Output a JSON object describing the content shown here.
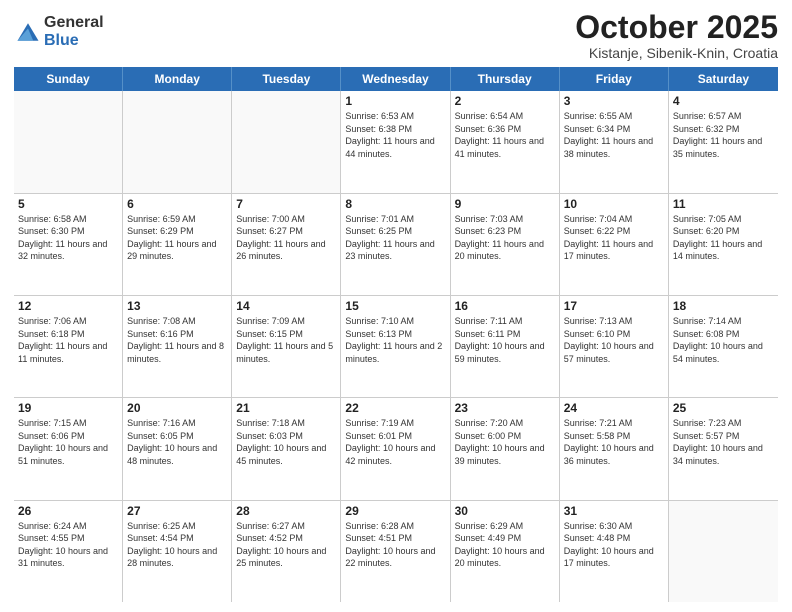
{
  "logo": {
    "general": "General",
    "blue": "Blue"
  },
  "title": "October 2025",
  "location": "Kistanje, Sibenik-Knin, Croatia",
  "days": [
    "Sunday",
    "Monday",
    "Tuesday",
    "Wednesday",
    "Thursday",
    "Friday",
    "Saturday"
  ],
  "rows": [
    [
      {
        "day": "",
        "text": ""
      },
      {
        "day": "",
        "text": ""
      },
      {
        "day": "",
        "text": ""
      },
      {
        "day": "1",
        "text": "Sunrise: 6:53 AM\nSunset: 6:38 PM\nDaylight: 11 hours and 44 minutes."
      },
      {
        "day": "2",
        "text": "Sunrise: 6:54 AM\nSunset: 6:36 PM\nDaylight: 11 hours and 41 minutes."
      },
      {
        "day": "3",
        "text": "Sunrise: 6:55 AM\nSunset: 6:34 PM\nDaylight: 11 hours and 38 minutes."
      },
      {
        "day": "4",
        "text": "Sunrise: 6:57 AM\nSunset: 6:32 PM\nDaylight: 11 hours and 35 minutes."
      }
    ],
    [
      {
        "day": "5",
        "text": "Sunrise: 6:58 AM\nSunset: 6:30 PM\nDaylight: 11 hours and 32 minutes."
      },
      {
        "day": "6",
        "text": "Sunrise: 6:59 AM\nSunset: 6:29 PM\nDaylight: 11 hours and 29 minutes."
      },
      {
        "day": "7",
        "text": "Sunrise: 7:00 AM\nSunset: 6:27 PM\nDaylight: 11 hours and 26 minutes."
      },
      {
        "day": "8",
        "text": "Sunrise: 7:01 AM\nSunset: 6:25 PM\nDaylight: 11 hours and 23 minutes."
      },
      {
        "day": "9",
        "text": "Sunrise: 7:03 AM\nSunset: 6:23 PM\nDaylight: 11 hours and 20 minutes."
      },
      {
        "day": "10",
        "text": "Sunrise: 7:04 AM\nSunset: 6:22 PM\nDaylight: 11 hours and 17 minutes."
      },
      {
        "day": "11",
        "text": "Sunrise: 7:05 AM\nSunset: 6:20 PM\nDaylight: 11 hours and 14 minutes."
      }
    ],
    [
      {
        "day": "12",
        "text": "Sunrise: 7:06 AM\nSunset: 6:18 PM\nDaylight: 11 hours and 11 minutes."
      },
      {
        "day": "13",
        "text": "Sunrise: 7:08 AM\nSunset: 6:16 PM\nDaylight: 11 hours and 8 minutes."
      },
      {
        "day": "14",
        "text": "Sunrise: 7:09 AM\nSunset: 6:15 PM\nDaylight: 11 hours and 5 minutes."
      },
      {
        "day": "15",
        "text": "Sunrise: 7:10 AM\nSunset: 6:13 PM\nDaylight: 11 hours and 2 minutes."
      },
      {
        "day": "16",
        "text": "Sunrise: 7:11 AM\nSunset: 6:11 PM\nDaylight: 10 hours and 59 minutes."
      },
      {
        "day": "17",
        "text": "Sunrise: 7:13 AM\nSunset: 6:10 PM\nDaylight: 10 hours and 57 minutes."
      },
      {
        "day": "18",
        "text": "Sunrise: 7:14 AM\nSunset: 6:08 PM\nDaylight: 10 hours and 54 minutes."
      }
    ],
    [
      {
        "day": "19",
        "text": "Sunrise: 7:15 AM\nSunset: 6:06 PM\nDaylight: 10 hours and 51 minutes."
      },
      {
        "day": "20",
        "text": "Sunrise: 7:16 AM\nSunset: 6:05 PM\nDaylight: 10 hours and 48 minutes."
      },
      {
        "day": "21",
        "text": "Sunrise: 7:18 AM\nSunset: 6:03 PM\nDaylight: 10 hours and 45 minutes."
      },
      {
        "day": "22",
        "text": "Sunrise: 7:19 AM\nSunset: 6:01 PM\nDaylight: 10 hours and 42 minutes."
      },
      {
        "day": "23",
        "text": "Sunrise: 7:20 AM\nSunset: 6:00 PM\nDaylight: 10 hours and 39 minutes."
      },
      {
        "day": "24",
        "text": "Sunrise: 7:21 AM\nSunset: 5:58 PM\nDaylight: 10 hours and 36 minutes."
      },
      {
        "day": "25",
        "text": "Sunrise: 7:23 AM\nSunset: 5:57 PM\nDaylight: 10 hours and 34 minutes."
      }
    ],
    [
      {
        "day": "26",
        "text": "Sunrise: 6:24 AM\nSunset: 4:55 PM\nDaylight: 10 hours and 31 minutes."
      },
      {
        "day": "27",
        "text": "Sunrise: 6:25 AM\nSunset: 4:54 PM\nDaylight: 10 hours and 28 minutes."
      },
      {
        "day": "28",
        "text": "Sunrise: 6:27 AM\nSunset: 4:52 PM\nDaylight: 10 hours and 25 minutes."
      },
      {
        "day": "29",
        "text": "Sunrise: 6:28 AM\nSunset: 4:51 PM\nDaylight: 10 hours and 22 minutes."
      },
      {
        "day": "30",
        "text": "Sunrise: 6:29 AM\nSunset: 4:49 PM\nDaylight: 10 hours and 20 minutes."
      },
      {
        "day": "31",
        "text": "Sunrise: 6:30 AM\nSunset: 4:48 PM\nDaylight: 10 hours and 17 minutes."
      },
      {
        "day": "",
        "text": ""
      }
    ]
  ]
}
